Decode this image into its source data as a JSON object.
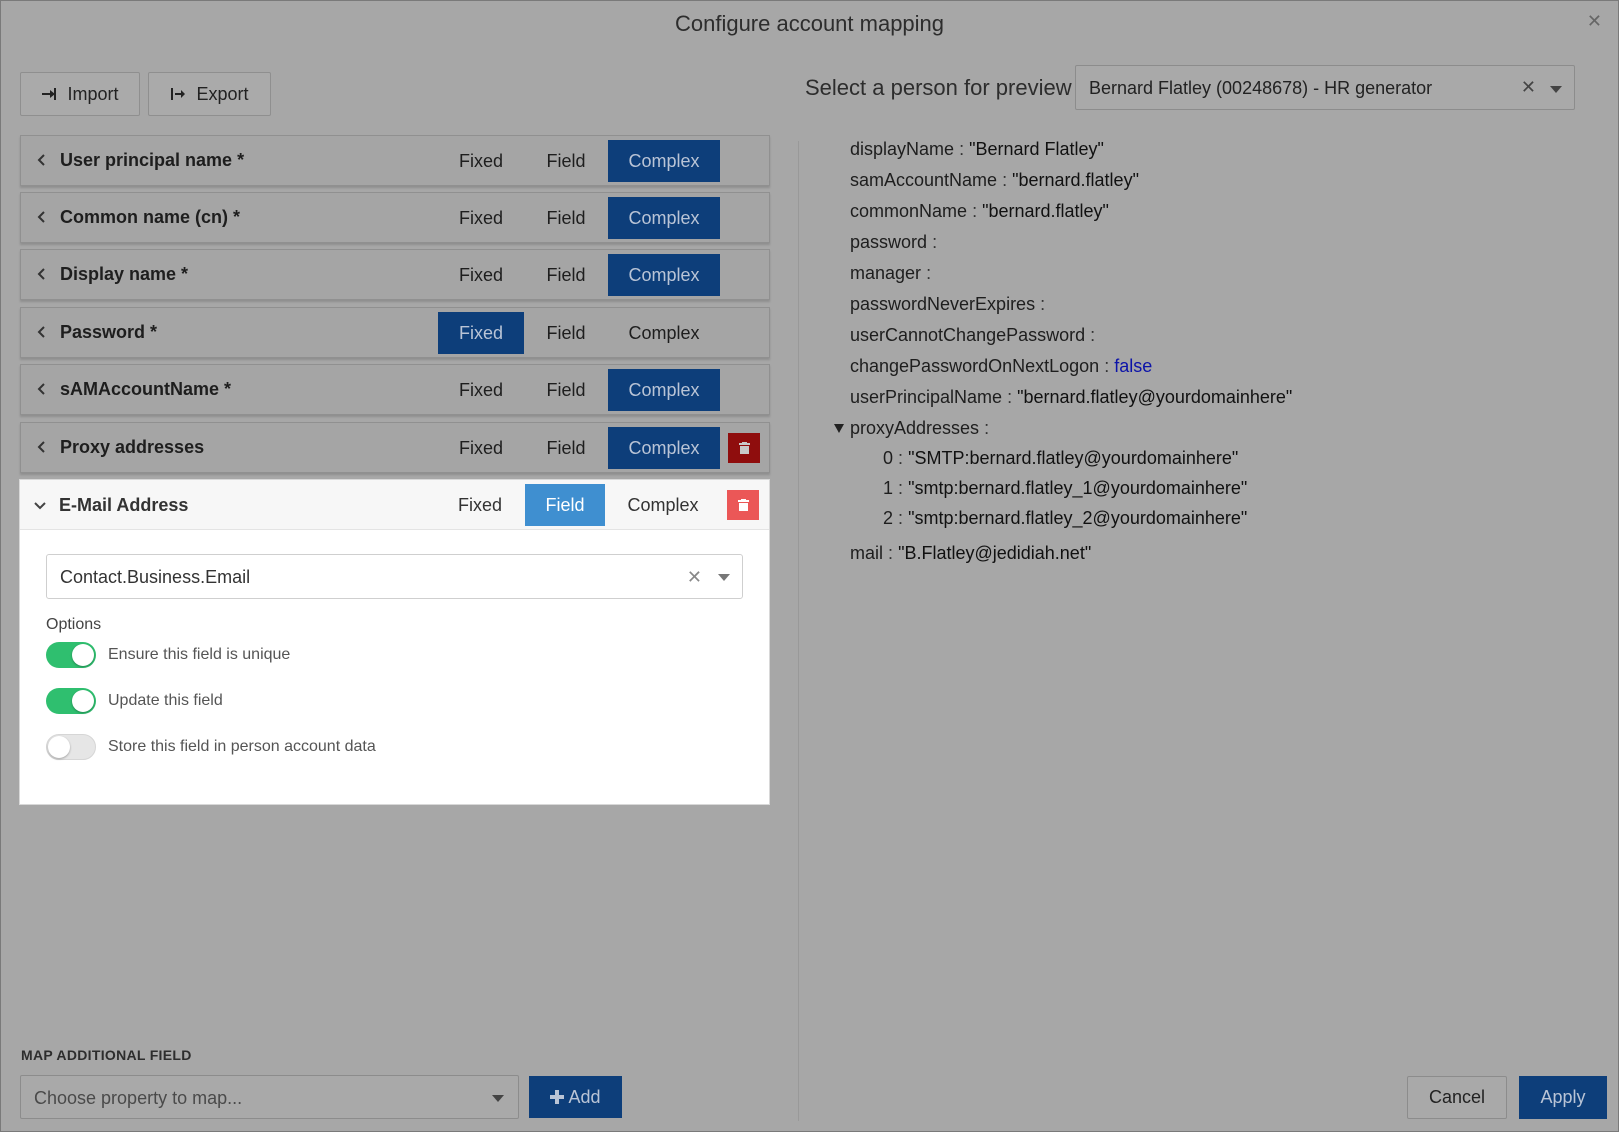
{
  "dialog": {
    "title": "Configure account mapping",
    "close_icon": "close-icon",
    "import_label": "Import",
    "export_label": "Export"
  },
  "segments": {
    "fixed": "Fixed",
    "field": "Field",
    "complex": "Complex"
  },
  "mappings": [
    {
      "label": "User principal name *",
      "mode": "Complex",
      "deletable": false
    },
    {
      "label": "Common name (cn) *",
      "mode": "Complex",
      "deletable": false
    },
    {
      "label": "Display name *",
      "mode": "Complex",
      "deletable": false
    },
    {
      "label": "Password *",
      "mode": "Fixed",
      "deletable": false
    },
    {
      "label": "sAMAccountName *",
      "mode": "Complex",
      "deletable": false
    },
    {
      "label": "Proxy addresses",
      "mode": "Complex",
      "deletable": true
    }
  ],
  "expanded": {
    "label": "E-Mail Address",
    "mode": "Field",
    "field_value": "Contact.Business.Email",
    "options_title": "Options",
    "options": [
      {
        "label": "Ensure this field is unique",
        "enabled": true
      },
      {
        "label": "Update this field",
        "enabled": true
      },
      {
        "label": "Store this field in person account data",
        "enabled": false
      }
    ]
  },
  "preview": {
    "label": "Select a person for preview",
    "person": "Bernard Flatley (00248678) - HR generator",
    "lines": {
      "displayName_k": "displayName",
      "displayName_v": "\"Bernard Flatley\"",
      "samAccountName_k": "samAccountName",
      "samAccountName_v": "\"bernard.flatley\"",
      "commonName_k": "commonName",
      "commonName_v": "\"bernard.flatley\"",
      "password_k": "password",
      "manager_k": "manager",
      "passwordNeverExpires_k": "passwordNeverExpires",
      "userCannotChangePassword_k": "userCannotChangePassword",
      "changePasswordOnNextLogon_k": "changePasswordOnNextLogon",
      "changePasswordOnNextLogon_v": "false",
      "userPrincipalName_k": "userPrincipalName",
      "userPrincipalName_v": "\"bernard.flatley@yourdomainhere\"",
      "proxyAddresses_k": "proxyAddresses",
      "proxy0_k": "0",
      "proxy0_v": "\"SMTP:bernard.flatley@yourdomainhere\"",
      "proxy1_k": "1",
      "proxy1_v": "\"smtp:bernard.flatley_1@yourdomainhere\"",
      "proxy2_k": "2",
      "proxy2_v": "\"smtp:bernard.flatley_2@yourdomainhere\"",
      "mail_k": "mail",
      "mail_v": "\"B.Flatley@jedidiah.net\""
    },
    "separator": ":",
    "boolean_color": "#0c13a8"
  },
  "footer": {
    "map_title": "MAP ADDITIONAL FIELD",
    "map_placeholder": "Choose property to map...",
    "add_label": "Add",
    "cancel_label": "Cancel",
    "apply_label": "Apply"
  },
  "colors": {
    "accent": "#0d3e7a",
    "accent_active_light": "#3f8fd0",
    "toggle_on": "#2fbf6f",
    "danger": "#eb5757"
  }
}
